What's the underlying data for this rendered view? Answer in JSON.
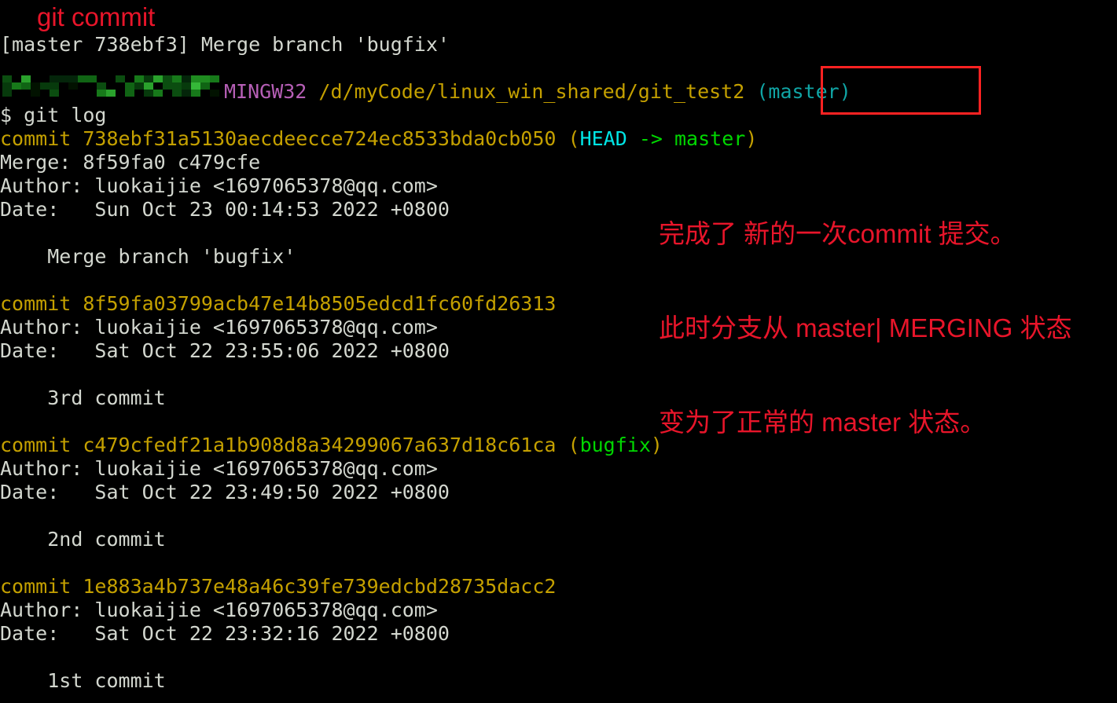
{
  "terminal": {
    "background_color": "#000000",
    "default_text_color": "#d3d7cf",
    "commit_hash_color": "#c4a000",
    "branch_color": "#00d700",
    "head_color": "#00e5e5",
    "prompt_host_color": "#b65fb6",
    "prompt_path_color": "#c4a000",
    "prompt_branch_color": "#10a5a5",
    "lines": {
      "commit_result": "[master 738ebf3] Merge branch 'bugfix'",
      "prompt_redacted_user": "",
      "prompt_mingw": "MINGW32",
      "prompt_path": "/d/myCode/linux_win_shared/git_test2",
      "prompt_branch": "(master)",
      "command_prompt_symbol": "$",
      "command": "git log"
    },
    "commits": [
      {
        "label": "commit",
        "hash": "738ebf31a5130aecdeecce724ec8533bda0cb050",
        "refs_open": "(",
        "ref_head": "HEAD",
        "ref_arrow": " -> ",
        "ref_branch": "master",
        "refs_close": ")",
        "merge_label": "Merge:",
        "merge_parents": "8f59fa0 c479cfe",
        "author_label": "Author:",
        "author": "luokaijie <1697065378@qq.com>",
        "date_label": "Date:",
        "date": "Sun Oct 23 00:14:53 2022 +0800",
        "message": "Merge branch 'bugfix'"
      },
      {
        "label": "commit",
        "hash": "8f59fa03799acb47e14b8505edcd1fc60fd26313",
        "author_label": "Author:",
        "author": "luokaijie <1697065378@qq.com>",
        "date_label": "Date:",
        "date": "Sat Oct 22 23:55:06 2022 +0800",
        "message": "3rd commit"
      },
      {
        "label": "commit",
        "hash": "c479cfedf21a1b908d8a34299067a637d18c61ca",
        "refs_open": "(",
        "ref_branch": "bugfix",
        "refs_close": ")",
        "author_label": "Author:",
        "author": "luokaijie <1697065378@qq.com>",
        "date_label": "Date:",
        "date": "Sat Oct 22 23:49:50 2022 +0800",
        "message": "2nd commit"
      },
      {
        "label": "commit",
        "hash": "1e883a4b737e48a46c39fe739edcbd28735dacc2",
        "author_label": "Author:",
        "author": "luokaijie <1697065378@qq.com>",
        "date_label": "Date:",
        "date": "Sat Oct 22 23:32:16 2022 +0800",
        "message": "1st commit"
      }
    ]
  },
  "annotations": {
    "color": "#e8152a",
    "title": "git commit",
    "note_line_1": "完成了 新的一次commit 提交。",
    "note_line_2": "此时分支从 master| MERGING 状态",
    "note_line_3": "变为了正常的 master 状态。",
    "highlight_box_target": "(master)"
  }
}
